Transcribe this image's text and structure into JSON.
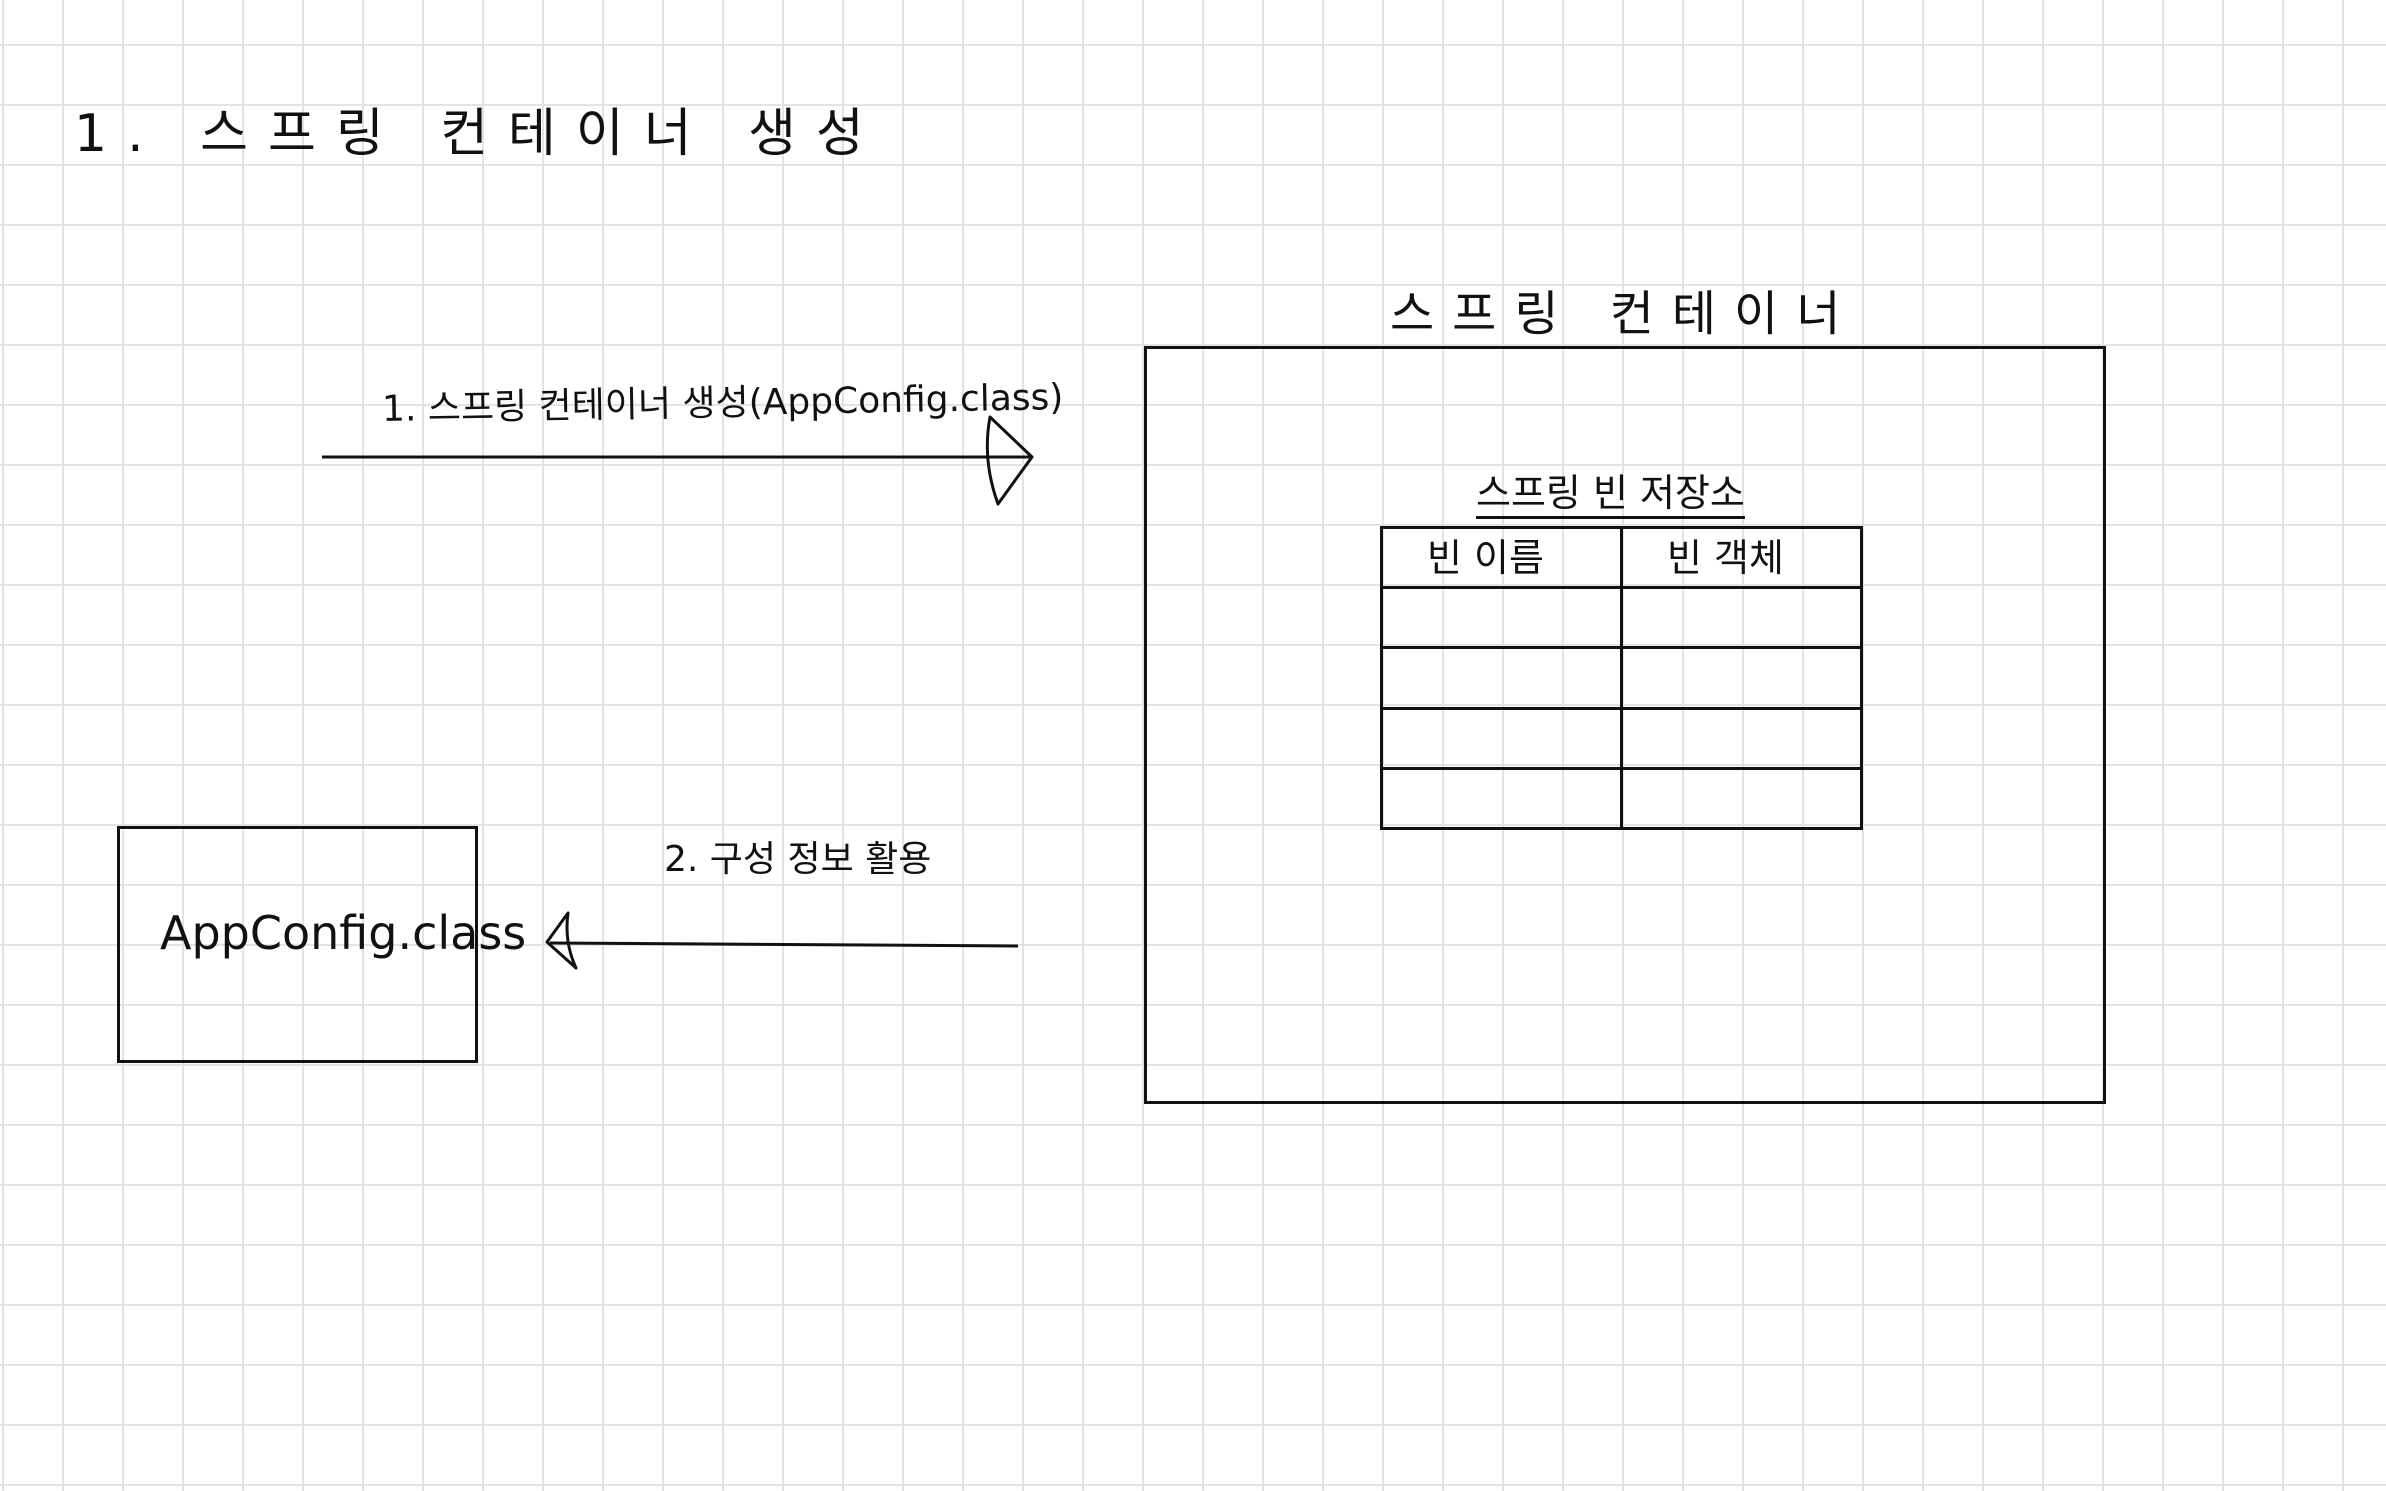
{
  "page": {
    "title": "1. 스프링 컨테이너 생성"
  },
  "arrows": {
    "create": {
      "label": "1. 스프링 컨테이너 생성(AppConfig.class)"
    },
    "config": {
      "label": "2. 구성 정보 활용"
    }
  },
  "appconfig": {
    "label": "AppConfig.class"
  },
  "spring_container": {
    "label": "스프링 컨테이너",
    "bean_store": {
      "title": "스프링 빈 저장소",
      "columns": [
        "빈 이름",
        "빈 객체"
      ],
      "rows": [
        [
          "",
          ""
        ],
        [
          "",
          ""
        ],
        [
          "",
          ""
        ],
        [
          "",
          ""
        ]
      ]
    }
  },
  "colors": {
    "ink": "#111111",
    "grid": "#e3e3e3",
    "background": "#ffffff"
  }
}
